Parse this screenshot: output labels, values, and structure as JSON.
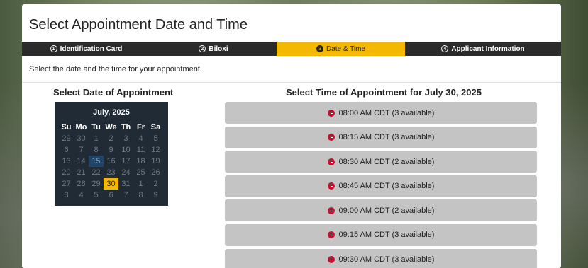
{
  "page_title": "Select Appointment Date and Time",
  "steps": [
    {
      "num": "1",
      "label": "Identification Card",
      "active": false
    },
    {
      "num": "2",
      "label": "Biloxi",
      "active": false
    },
    {
      "num": "3",
      "label": "Date & Time",
      "active": true
    },
    {
      "num": "4",
      "label": "Applicant Information",
      "active": false
    }
  ],
  "instruction": "Select the date and the time for your appointment.",
  "date_heading": "Select Date of Appointment",
  "time_heading": "Select Time of Appointment for July 30, 2025",
  "calendar": {
    "month": "July, 2025",
    "weekdays": [
      "Su",
      "Mo",
      "Tu",
      "We",
      "Th",
      "Fr",
      "Sa"
    ],
    "weeks": [
      [
        "29",
        "30",
        "1",
        "2",
        "3",
        "4",
        "5"
      ],
      [
        "6",
        "7",
        "8",
        "9",
        "10",
        "11",
        "12"
      ],
      [
        "13",
        "14",
        "15",
        "16",
        "17",
        "18",
        "19"
      ],
      [
        "20",
        "21",
        "22",
        "23",
        "24",
        "25",
        "26"
      ],
      [
        "27",
        "28",
        "29",
        "30",
        "31",
        "1",
        "2"
      ],
      [
        "3",
        "4",
        "5",
        "6",
        "7",
        "8",
        "9"
      ]
    ],
    "today_label": "15",
    "selected_label": "30"
  },
  "time_slots": [
    "08:00 AM CDT (3 available)",
    "08:15 AM CDT (3 available)",
    "08:30 AM CDT (2 available)",
    "08:45 AM CDT (3 available)",
    "09:00 AM CDT (2 available)",
    "09:15 AM CDT (3 available)",
    "09:30 AM CDT (3 available)"
  ],
  "colors": {
    "accent": "#f5b800",
    "step_bar": "#2b2b2b",
    "calendar_bg": "#202b36",
    "clock_icon": "#c8102e",
    "slot_bg": "#c4c4c4"
  }
}
